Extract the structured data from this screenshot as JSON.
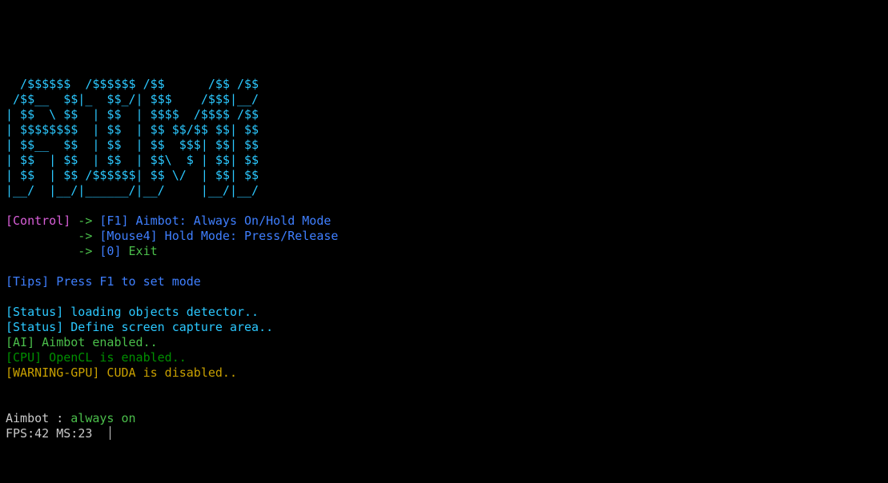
{
  "ascii": {
    "l1": "  /$$$$$$  /$$$$$$ /$$      /$$ /$$",
    "l2": " /$$__  $$|_  $$_/| $$$    /$$$|__/",
    "l3": "| $$  \\ $$  | $$  | $$$$  /$$$$ /$$",
    "l4": "| $$$$$$$$  | $$  | $$ $$/$$ $$| $$",
    "l5": "| $$__  $$  | $$  | $$  $$$| $$| $$",
    "l6": "| $$  | $$  | $$  | $$\\  $ | $$| $$",
    "l7": "| $$  | $$ /$$$$$$| $$ \\/  | $$| $$",
    "l8": "|__/  |__/|______/|__/     |__/|__/"
  },
  "controls": {
    "label": "[Control]",
    "arrow": " -> ",
    "indent": "          -> ",
    "f1_key": "[F1]",
    "f1_desc": " Aimbot: Always On/Hold Mode",
    "mouse4_key": "[Mouse4]",
    "mouse4_desc": " Hold Mode: Press/Release",
    "exit_key": "[0]",
    "exit_desc": " Exit"
  },
  "tips": {
    "label": "[Tips]",
    "text": " Press F1 to set mode"
  },
  "status": {
    "s1_label": "[Status]",
    "s1_text": " loading objects detector..",
    "s2_label": "[Status]",
    "s2_text": " Define screen capture area..",
    "ai_label": "[AI]",
    "ai_text": " Aimbot enabled..",
    "cpu_label": "[CPU]",
    "cpu_text": " OpenCL is enabled..",
    "warn_label": "[WARNING-GPU]",
    "warn_text": " CUDA is disabled.."
  },
  "footer": {
    "aimbot_label": "Aimbot : ",
    "aimbot_value": "always on",
    "fps_label": "FPS:",
    "fps_value": "42",
    "ms_label": " MS:",
    "ms_value": "23"
  }
}
